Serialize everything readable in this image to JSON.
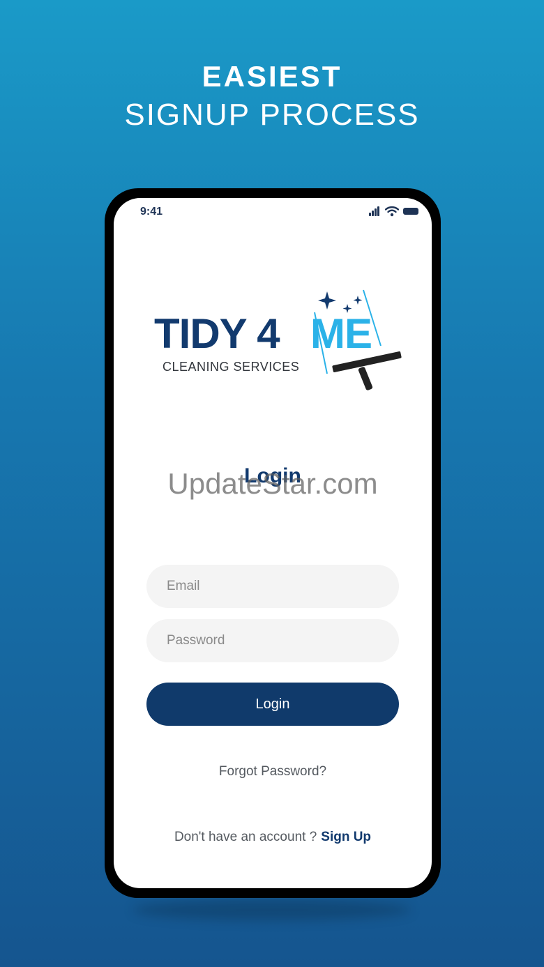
{
  "headline": {
    "line1": "EASIEST",
    "line2": "SIGNUP PROCESS"
  },
  "status_bar": {
    "time": "9:41",
    "icons": [
      "signal-icon",
      "wifi-icon",
      "battery-icon"
    ]
  },
  "logo": {
    "brand_part1": "TIDY 4 ",
    "brand_part2": "ME",
    "subtitle": "CLEANING SERVICES"
  },
  "login": {
    "title": "Login",
    "email_placeholder": "Email",
    "password_placeholder": "Password",
    "button_label": "Login",
    "forgot_password": "Forgot Password?",
    "signup_prompt": "Don't have an account ?",
    "signup_link": "Sign Up"
  },
  "watermark": "UpdateStar.com",
  "colors": {
    "brand_navy": "#123a6e",
    "brand_cyan": "#2bb2e8",
    "button_bg": "#103a6b",
    "field_bg": "#f4f4f4"
  }
}
